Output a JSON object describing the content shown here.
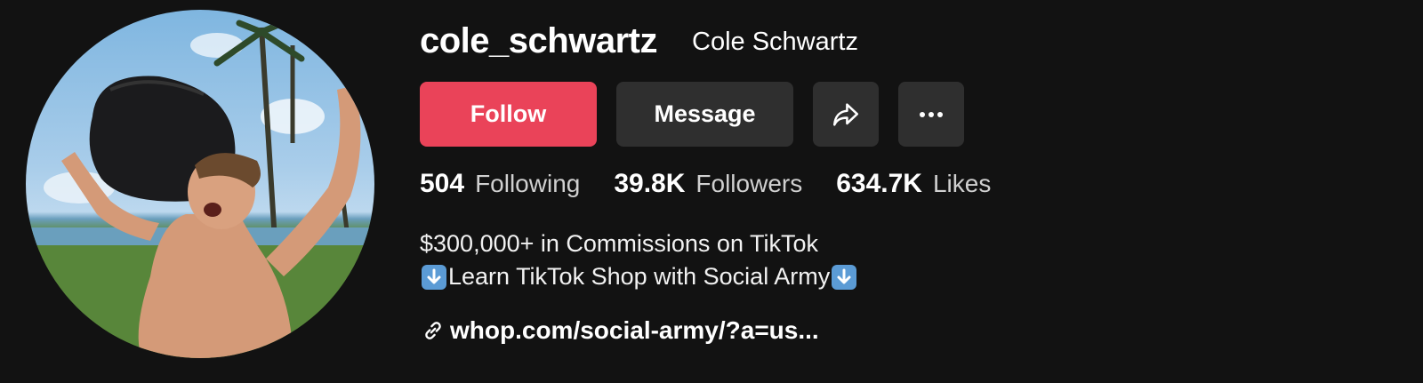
{
  "profile": {
    "username": "cole_schwartz",
    "display_name": "Cole Schwartz",
    "avatar_icon": "profile-photo"
  },
  "actions": {
    "follow_label": "Follow",
    "message_label": "Message",
    "share_icon": "share-icon",
    "more_icon": "more-icon"
  },
  "stats": [
    {
      "value": "504",
      "label": "Following"
    },
    {
      "value": "39.8K",
      "label": "Followers"
    },
    {
      "value": "634.7K",
      "label": "Likes"
    }
  ],
  "bio": {
    "line1": "$300,000+ in Commissions on TikTok",
    "line2": "Learn TikTok Shop with Social Army"
  },
  "link": {
    "text": "whop.com/social-army/?a=us...",
    "icon": "link-icon"
  },
  "colors": {
    "background": "#121212",
    "follow_button": "#ea4359",
    "secondary_button": "#2f2f2f"
  }
}
